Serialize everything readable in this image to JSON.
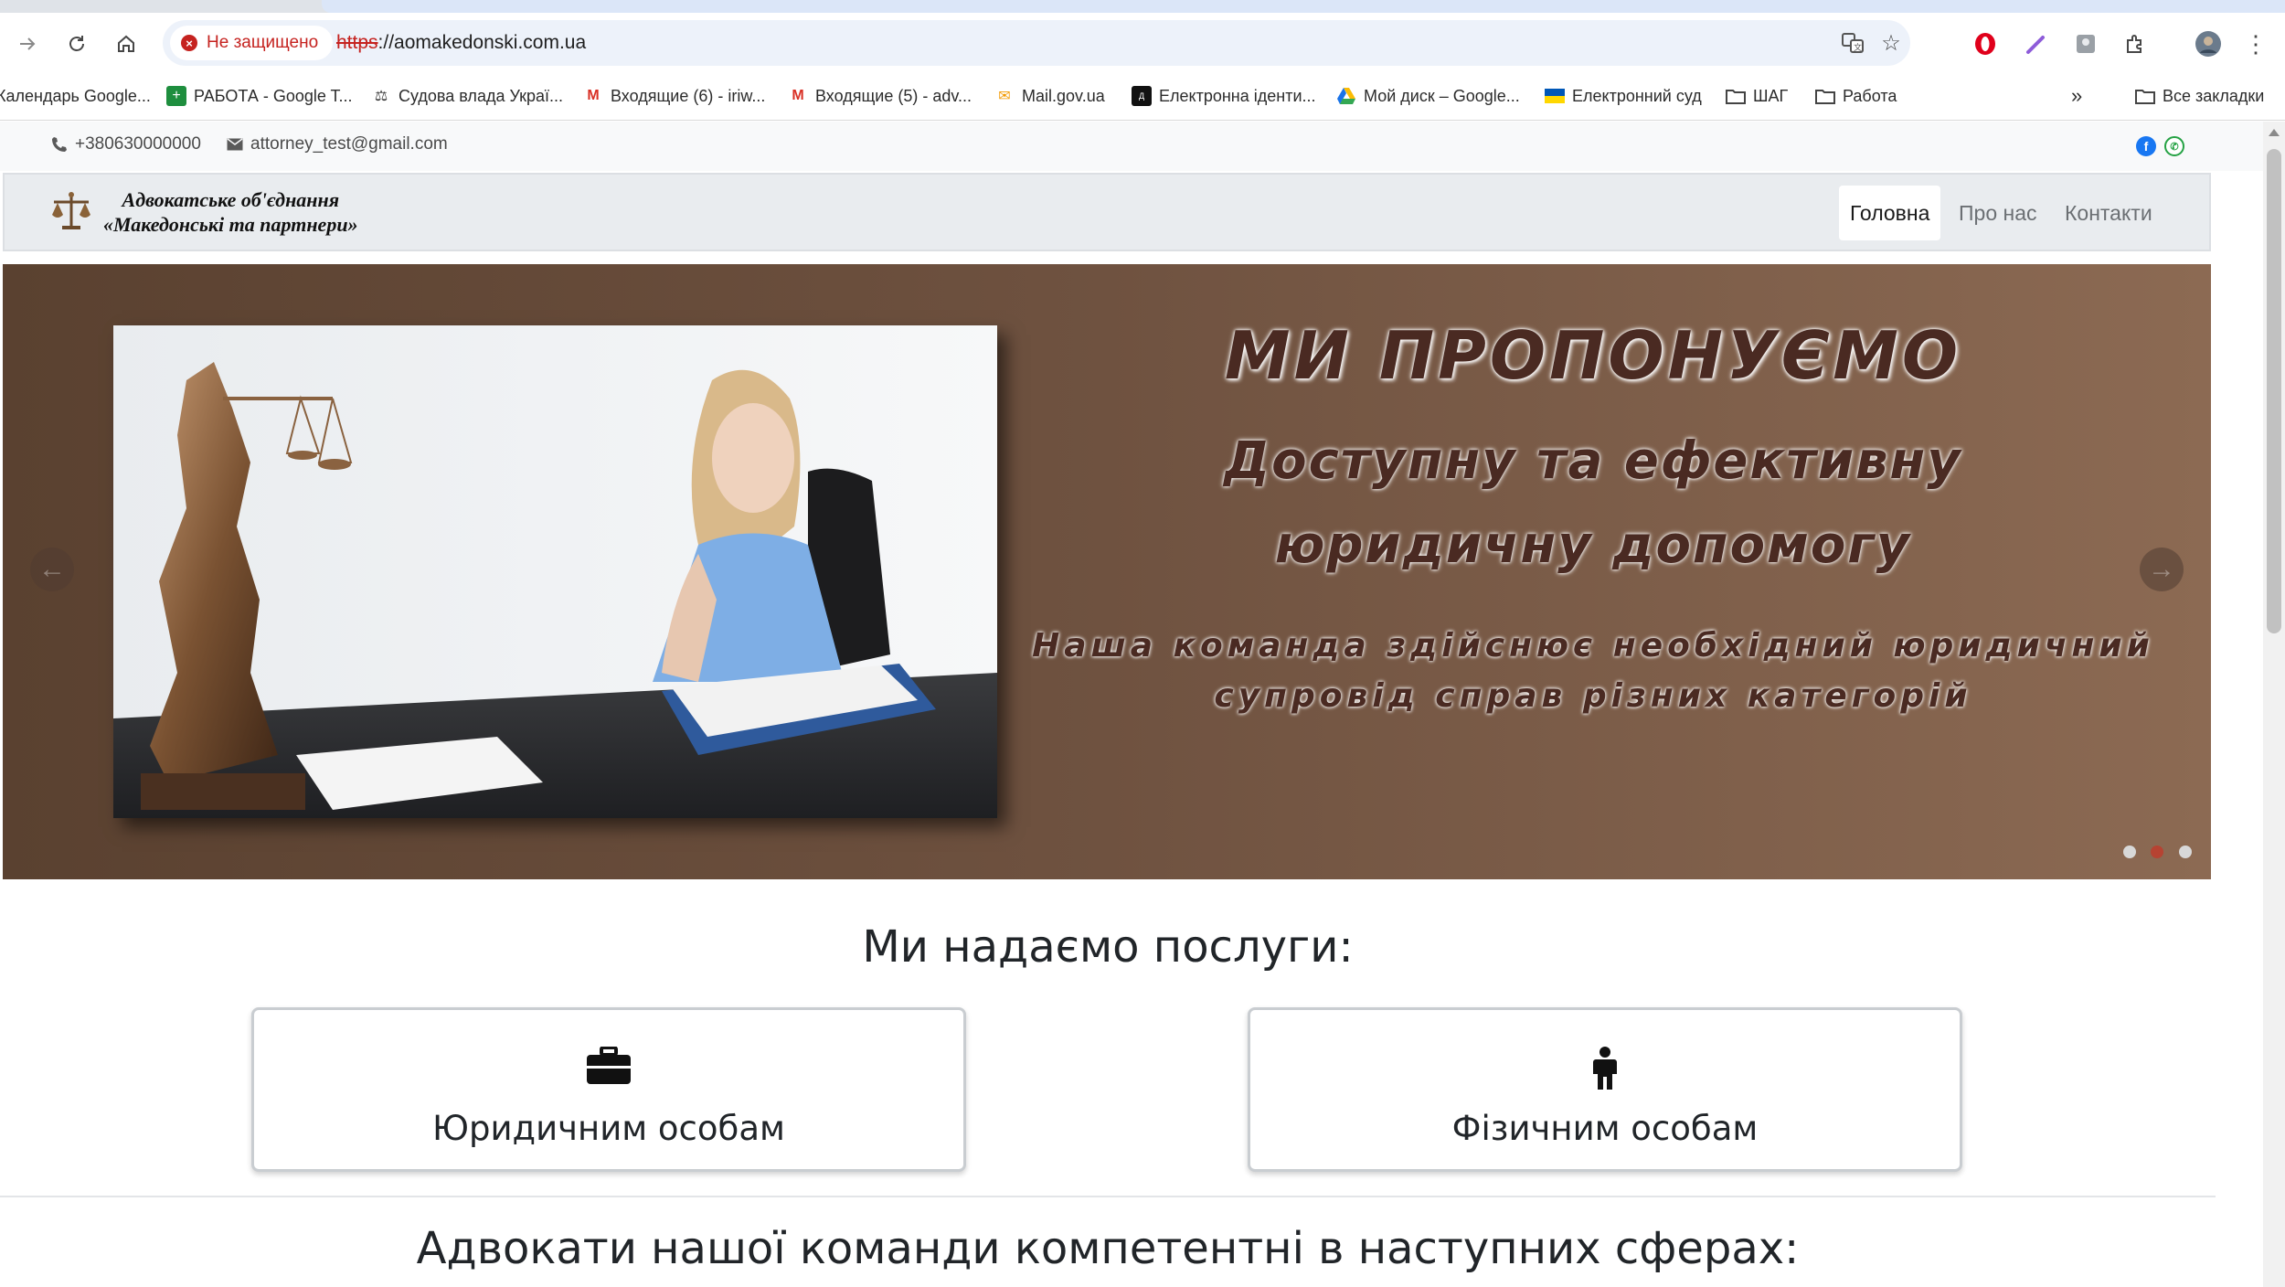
{
  "browser": {
    "security_label": "Не защищено",
    "url_scheme": "https",
    "url_rest": "://aomakedonski.com.ua",
    "bookmarks": [
      {
        "label": "Календарь Google...",
        "icon": "calendar-icon"
      },
      {
        "label": "РАБОТА - Google T...",
        "icon": "sheets-icon"
      },
      {
        "label": "Судова влада Украї...",
        "icon": "justice-icon"
      },
      {
        "label": "Входящие (6) - iriw...",
        "icon": "gmail-icon"
      },
      {
        "label": "Входящие (5) - adv...",
        "icon": "gmail-icon"
      },
      {
        "label": "Mail.gov.ua",
        "icon": "mail-icon"
      },
      {
        "label": "Електронна іденти...",
        "icon": "diia-icon"
      },
      {
        "label": "Мой диск – Google...",
        "icon": "drive-icon"
      },
      {
        "label": "Електронний суд",
        "icon": "flag-icon"
      },
      {
        "label": "ШАГ",
        "icon": "folder-icon"
      },
      {
        "label": "Работа",
        "icon": "folder-icon"
      }
    ],
    "more_bookmarks": "»",
    "all_bookmarks": "Все закладки"
  },
  "topbar": {
    "phone": "+380630000000",
    "email": "attorney_test@gmail.com"
  },
  "brand": {
    "line1": "Адвокатське об'єднання",
    "line2": "«Македонські та партнери»"
  },
  "nav": {
    "items": [
      {
        "label": "Головна",
        "active": true
      },
      {
        "label": "Про нас",
        "active": false
      },
      {
        "label": "Контакти",
        "active": false
      }
    ]
  },
  "carousel": {
    "title": "МИ ПРОПОНУЄМО",
    "subtitle_line1": "Доступну та ефективну",
    "subtitle_line2": "юридичну допомогу",
    "desc_line1": "Наша команда здійснює необхідний юридичний",
    "desc_line2": "супровід справ різних категорій",
    "active_slide": 2,
    "slide_count": 3
  },
  "services": {
    "title": "Ми надаємо послуги:",
    "cards": [
      {
        "label": "Юридичним особам",
        "icon": "briefcase-icon"
      },
      {
        "label": "Фізичним особам",
        "icon": "person-icon"
      }
    ]
  },
  "areas": {
    "title": "Адвокати нашої команди компетентні в наступних сферах:"
  }
}
